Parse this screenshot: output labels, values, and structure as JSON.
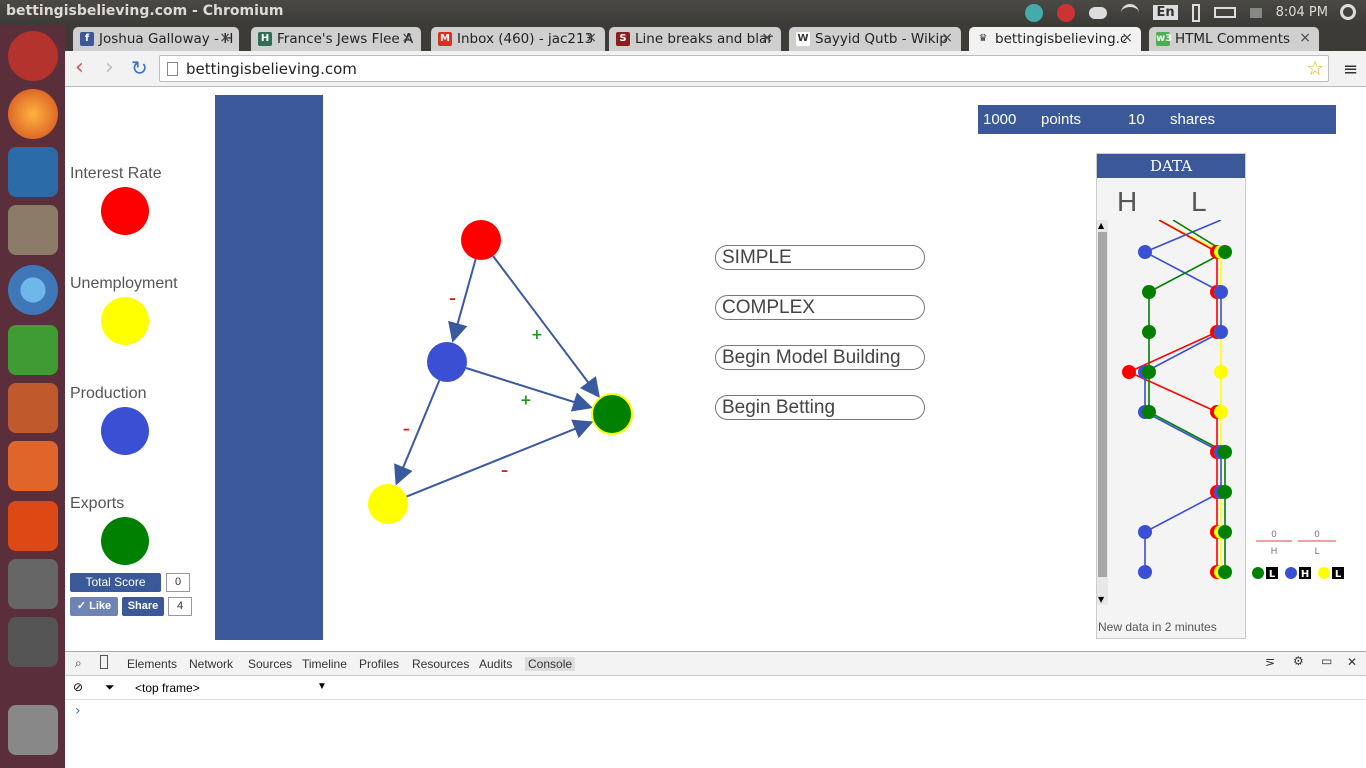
{
  "window": {
    "title": "bettingisbelieving.com - Chromium",
    "clock": "8:04 PM",
    "keyboard": "En"
  },
  "tabs": [
    {
      "label": "Joshua Galloway - H",
      "icon": "facebook-icon",
      "color": "#3b5998",
      "glyph": "f"
    },
    {
      "label": "France's Jews Flee A",
      "icon": "h-favicon",
      "color": "#2f6e55",
      "glyph": "H"
    },
    {
      "label": "Inbox (460) - jac213",
      "icon": "gmail-icon",
      "color": "#d93025",
      "glyph": "M"
    },
    {
      "label": "Line breaks and blar",
      "icon": "s-favicon",
      "color": "#8b1e1e",
      "glyph": "S"
    },
    {
      "label": "Sayyid Qutb - Wikip",
      "icon": "wikipedia-icon",
      "color": "#ffffff",
      "glyph": "W"
    },
    {
      "label": "bettingisbelieving.c",
      "icon": "crown-icon",
      "color": "#f2f2f2",
      "glyph": "♛"
    },
    {
      "label": "HTML Comments",
      "icon": "w3-icon",
      "color": "#4caf50",
      "glyph": "w3"
    }
  ],
  "address": {
    "url": "bettingisbelieving.com"
  },
  "legend": [
    {
      "label": "Interest Rate",
      "color": "#ff0000"
    },
    {
      "label": "Unemployment",
      "color": "#ffff00"
    },
    {
      "label": "Production",
      "color": "#3a4fd4"
    },
    {
      "label": "Exports",
      "color": "#008000"
    }
  ],
  "social": {
    "total_score_label": "Total Score",
    "total_score": "0",
    "like_label": "Like",
    "share_label": "Share",
    "share_count": "4"
  },
  "menu": [
    "SIMPLE",
    "COMPLEX",
    "Begin Model Building",
    "Begin Betting"
  ],
  "graph": {
    "edges": [
      {
        "from": "Interest Rate",
        "to": "Production",
        "sign": "–"
      },
      {
        "from": "Interest Rate",
        "to": "Exports",
        "sign": "+"
      },
      {
        "from": "Production",
        "to": "Exports",
        "sign": "+"
      },
      {
        "from": "Production",
        "to": "Unemployment",
        "sign": "–"
      },
      {
        "from": "Unemployment",
        "to": "Exports",
        "sign": "–"
      }
    ]
  },
  "scorebar": {
    "points": "1000",
    "points_label": "points",
    "shares": "10",
    "shares_label": "shares"
  },
  "data_panel": {
    "title": "DATA",
    "col_high": "H",
    "col_low": "L",
    "footer": "New data in 2 minutes"
  },
  "side_key": {
    "h_value": "0",
    "h_label": "H",
    "l_value": "0",
    "l_label": "L",
    "badge_l": "L",
    "badge_h": "H"
  },
  "devtools": {
    "tabs": [
      "Elements",
      "Network",
      "Sources",
      "Timeline",
      "Profiles",
      "Resources",
      "Audits",
      "Console"
    ],
    "frame": "<top frame>",
    "prompt": "›"
  }
}
